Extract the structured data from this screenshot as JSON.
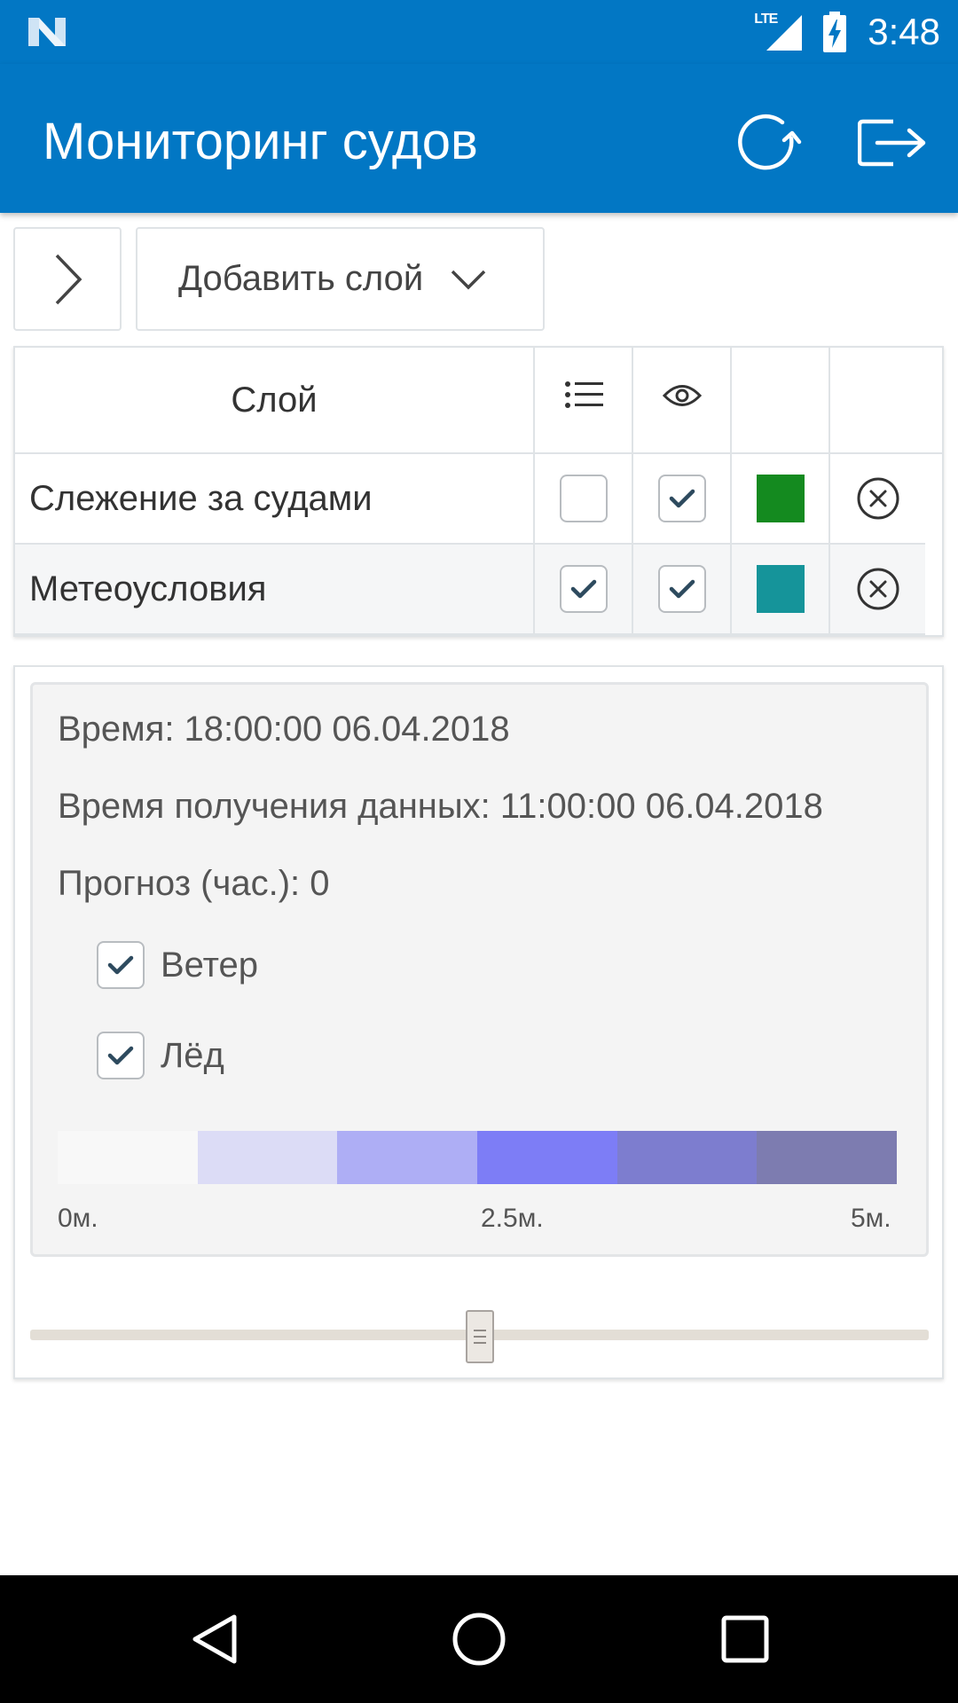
{
  "status_bar": {
    "network": "LTE",
    "time": "3:48",
    "left_icon": "n-notification-icon"
  },
  "app_bar": {
    "title": "Мониторинг судов",
    "refresh_icon": "refresh-icon",
    "logout_icon": "logout-icon"
  },
  "toolbar": {
    "add_layer_label": "Добавить слой"
  },
  "layers_table": {
    "header": {
      "layer_label": "Слой"
    },
    "rows": [
      {
        "name": "Слежение за судами",
        "list_checked": false,
        "visible_checked": true,
        "color": "#148a1f"
      },
      {
        "name": "Метеоусловия",
        "list_checked": true,
        "visible_checked": true,
        "color": "#15949a"
      }
    ]
  },
  "info": {
    "time_line": "Время: 18:00:00 06.04.2018",
    "data_time_line": "Время получения данных: 11:00:00 06.04.2018",
    "forecast_line": "Прогноз (час.): 0",
    "options": [
      {
        "label": "Ветер",
        "checked": true
      },
      {
        "label": "Лёд",
        "checked": true
      }
    ],
    "legend": {
      "colors": [
        "#f8f8f8",
        "#dcdcf6",
        "#aeaef5",
        "#7d7df6",
        "#7d7dcf",
        "#7d7cb0"
      ],
      "ticks": [
        "0м.",
        "2.5м.",
        "5м."
      ]
    },
    "slider_value": 0.5
  },
  "colors": {
    "primary": "#0277c4",
    "check": "#2d4a5e"
  }
}
